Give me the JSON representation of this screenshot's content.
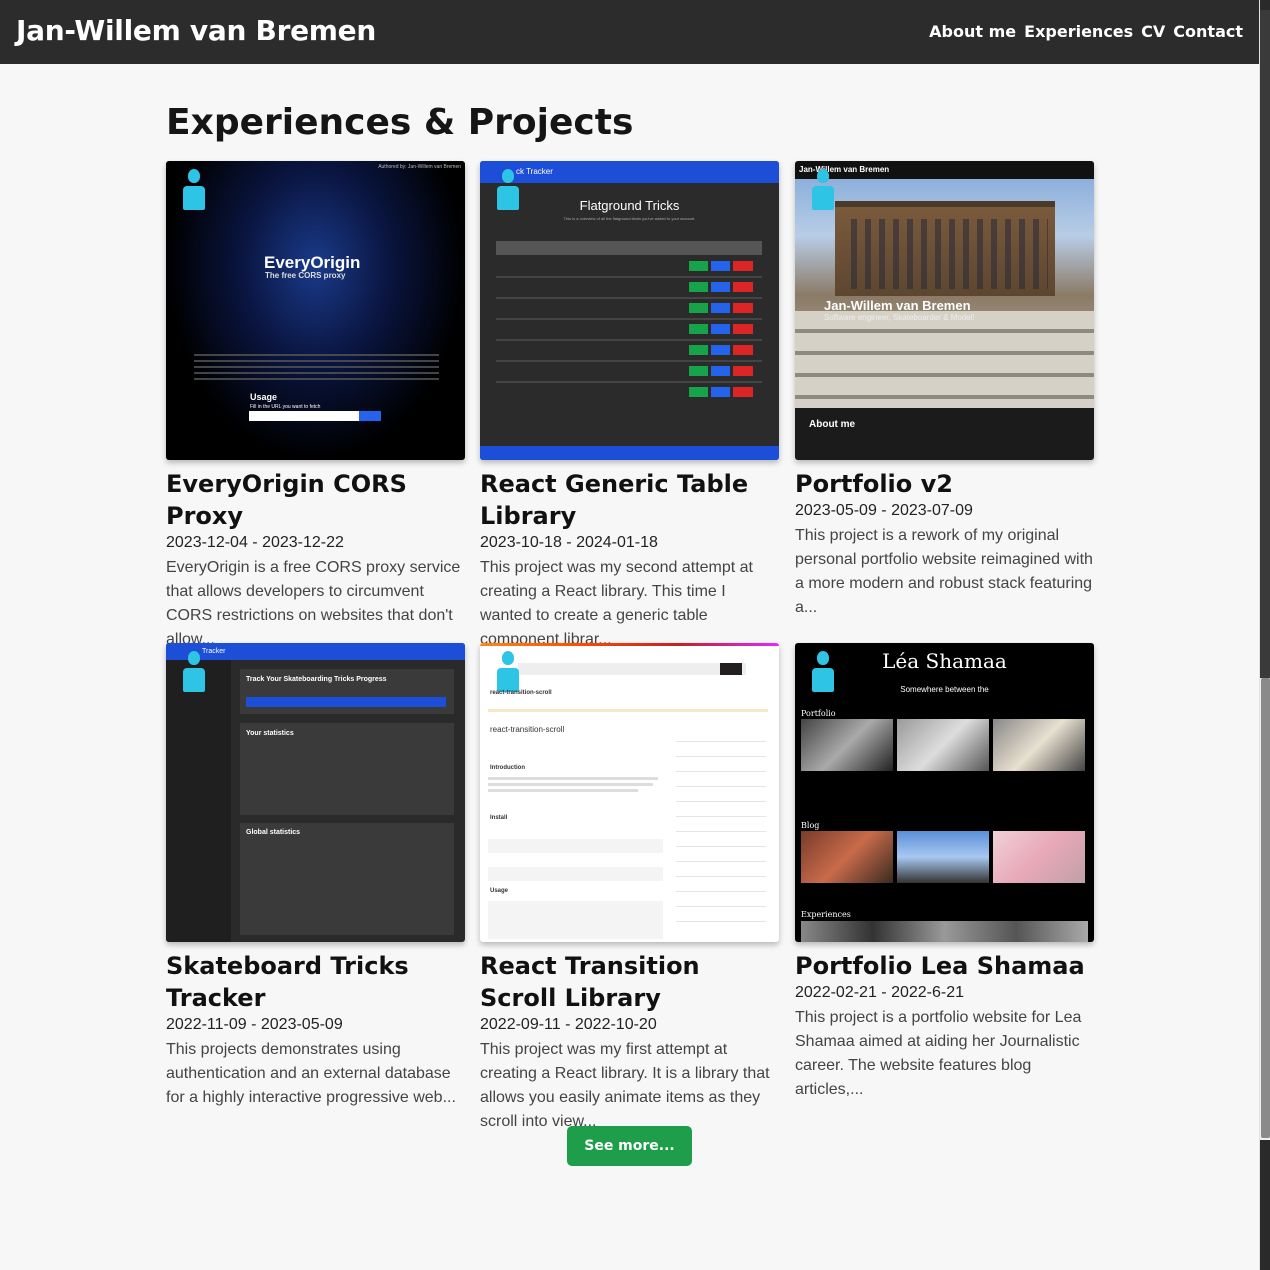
{
  "header": {
    "site_title": "Jan-Willem van Bremen",
    "nav": [
      "About me",
      "Experiences",
      "CV",
      "Contact"
    ]
  },
  "main": {
    "heading": "Experiences & Projects",
    "see_more": "See more...",
    "cards": [
      {
        "title": "EveryOrigin CORS Proxy",
        "date": "2023-12-04 - 2023-12-22",
        "description": "EveryOrigin is a free CORS proxy service that allows developers to circumvent CORS restrictions on websites that don't allow...",
        "thumb": {
          "title": "EveryOrigin",
          "subtitle": "The free CORS proxy",
          "authored": "Authored by: Jan-Willem van Bremen",
          "usage": "Usage",
          "fill": "Fill in the URL you want to fetch"
        }
      },
      {
        "title": "React Generic Table Library",
        "date": "2023-10-18 - 2024-01-18",
        "description": "This project was my second attempt at creating a React library. This time I wanted to create a generic table component librar...",
        "thumb": {
          "app": "ck Tracker",
          "title": "Flatground Tricks",
          "subtitle": "This is a overview of all the flatground tricks you've added to your account."
        }
      },
      {
        "title": "Portfolio v2",
        "date": "2023-05-09 - 2023-07-09",
        "description": "This project is a rework of my original personal portfolio website reimagined with a more modern and robust stack featuring a...",
        "thumb": {
          "brand": "Jan-Willem van Bremen",
          "hero": "Jan-Willem van Bremen",
          "hero_sub": "Software engineer, Skateboarder & Model!",
          "about": "About me"
        }
      },
      {
        "title": "Skateboard Tricks Tracker",
        "date": "2022-11-09 - 2023-05-09",
        "description": "This projects demonstrates using authentication and an external database for a highly interactive progressive web...",
        "thumb": {
          "app": "Tracker",
          "progress": "Track Your Skateboarding Tricks Progress",
          "your_stats": "Your statistics",
          "global_stats": "Global statistics"
        }
      },
      {
        "title": "React Transition Scroll Library",
        "date": "2022-09-11 - 2022-10-20",
        "description": "This project was my first attempt at creating a React library. It is a library that allows you easily animate items as they scroll into view...",
        "thumb": {
          "package": "react-transition-scroll",
          "intro": "Introduction",
          "install": "Install",
          "usage": "Usage"
        }
      },
      {
        "title": "Portfolio Lea Shamaa",
        "date": "2022-02-21 - 2022-6-21",
        "description": "This project is a portfolio website for Lea Shamaa aimed at aiding her Journalistic career. The website features blog articles,...",
        "thumb": {
          "title": "Léa Shamaa",
          "subtitle": "Somewhere between the",
          "portfolio": "Portfolio",
          "blog": "Blog",
          "experiences": "Experiences"
        }
      }
    ]
  },
  "colors": {
    "header_bg": "#2c2c2c",
    "button_green": "#1e9e4a",
    "accent_cyan": "#2ec4e6"
  }
}
